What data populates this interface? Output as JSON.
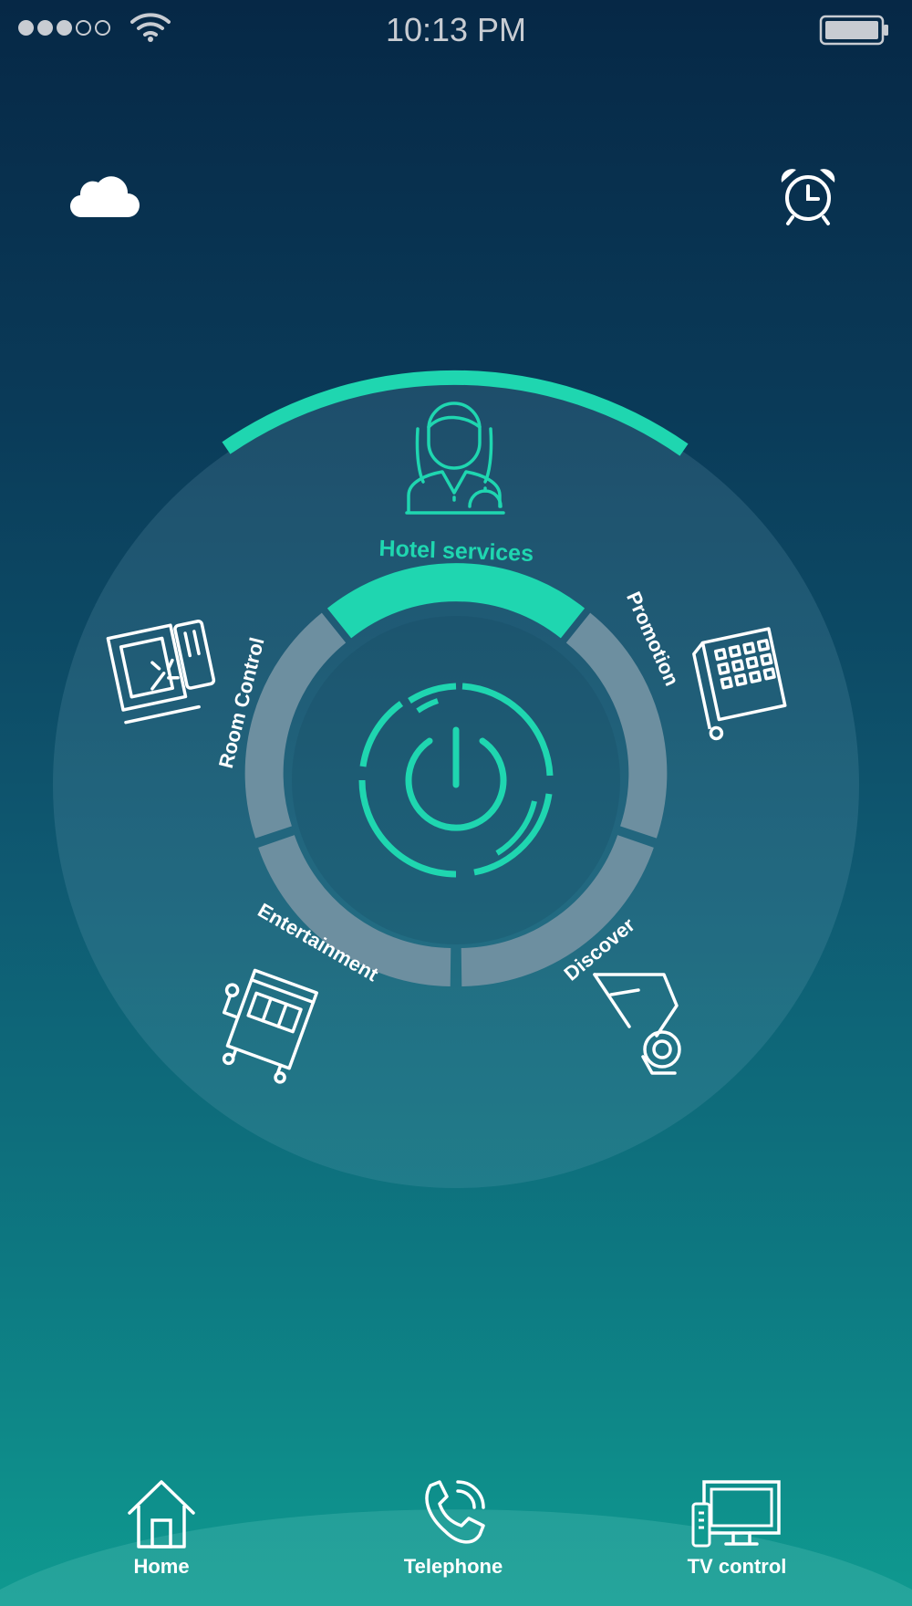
{
  "status_bar": {
    "time": "10:13 PM",
    "signal_bars_filled": 3,
    "signal_bars_total": 5
  },
  "header": {
    "left_icon": "cloud-icon",
    "right_icon": "alarm-clock-icon"
  },
  "dial": {
    "selected": "Hotel services",
    "center_icon": "power-icon",
    "items": [
      {
        "label": "Hotel services",
        "icon": "receptionist-icon"
      },
      {
        "label": "Promotion",
        "icon": "building-icon"
      },
      {
        "label": "Discover",
        "icon": "map-pin-icon"
      },
      {
        "label": "Entertainment",
        "icon": "slot-machine-icon"
      },
      {
        "label": "Room Control",
        "icon": "keycard-icon"
      }
    ]
  },
  "tab_bar": {
    "items": [
      {
        "label": "Home",
        "icon": "home-icon"
      },
      {
        "label": "Telephone",
        "icon": "phone-icon"
      },
      {
        "label": "TV control",
        "icon": "tv-icon"
      }
    ]
  },
  "colors": {
    "accent": "#1fd6b0",
    "text": "#ffffff",
    "status_text": "#c8ccd2"
  }
}
